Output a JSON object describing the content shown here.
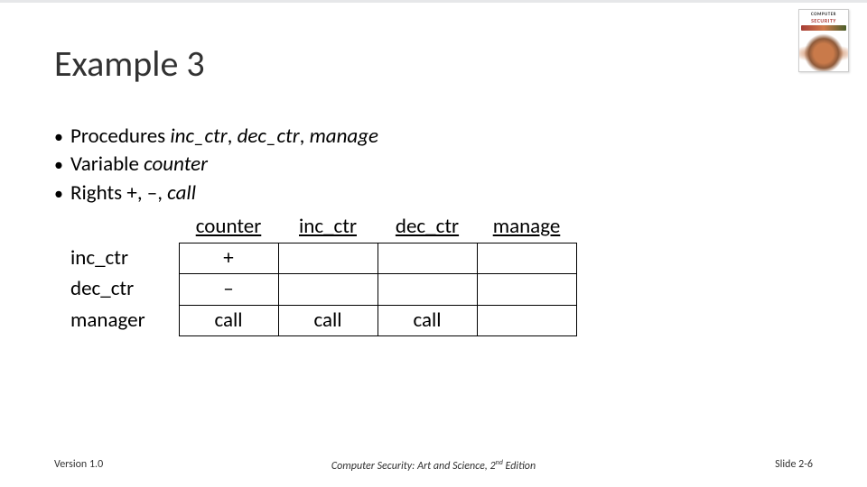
{
  "watermark": "",
  "book": {
    "line1": "COMPUTER",
    "line2": "SECURITY"
  },
  "title": "Example 3",
  "bullets": [
    {
      "prefix": "Procedures ",
      "italic": "inc_ctr",
      "sep1": ", ",
      "italic2": "dec_ctr",
      "sep2": ", ",
      "italic3": "manage"
    },
    {
      "prefix": "Variable ",
      "italic": "counter"
    },
    {
      "prefix": "Rights ",
      "mixed": "+, –, ",
      "italic": "call"
    }
  ],
  "table": {
    "col_headers": [
      "counter",
      "inc_ctr",
      "dec_ctr",
      "manage"
    ],
    "rows": [
      {
        "label": "inc_ctr",
        "cells": [
          "+",
          "",
          "",
          ""
        ]
      },
      {
        "label": "dec_ctr",
        "cells": [
          "–",
          "",
          "",
          ""
        ]
      },
      {
        "label": "manager",
        "cells": [
          "call",
          "call",
          "call",
          ""
        ]
      }
    ]
  },
  "footer": {
    "left": "Version 1.0",
    "center_pre": "Computer Security: Art and Science, 2",
    "center_sup": "nd",
    "center_post": " Edition",
    "right": "Slide 2-6"
  }
}
